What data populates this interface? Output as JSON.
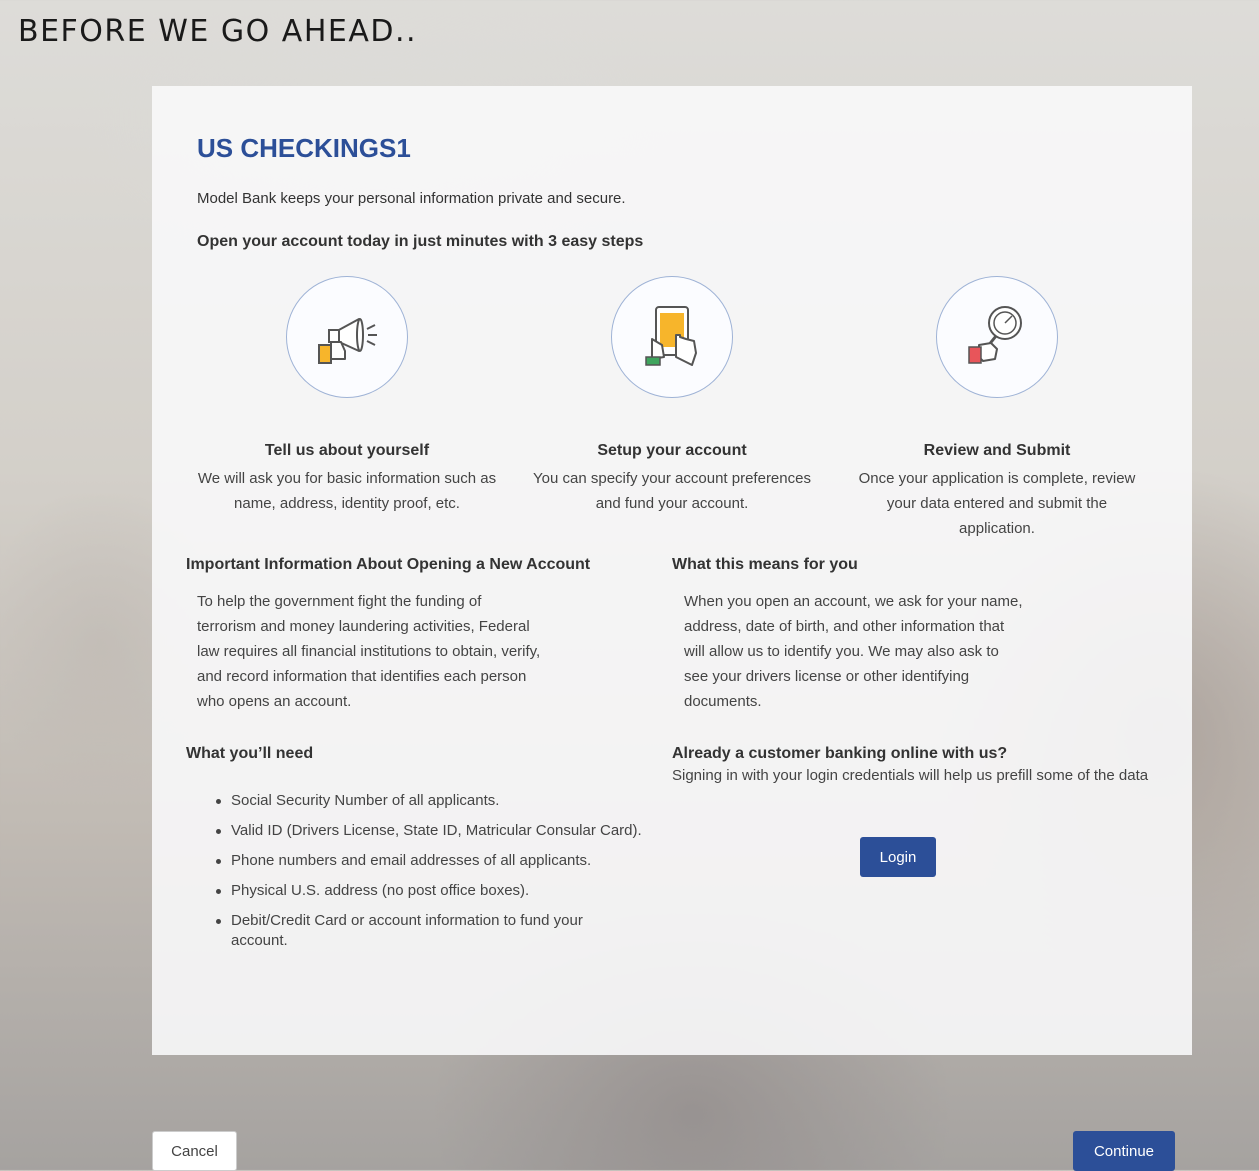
{
  "page": {
    "title": "BEFORE WE GO AHEAD.."
  },
  "product": {
    "name": "US CHECKINGS1"
  },
  "intro": {
    "privacy_text": "Model Bank keeps your personal information private and secure.",
    "steps_heading": "Open your account today in just minutes with 3 easy steps"
  },
  "steps": [
    {
      "icon": "megaphone-icon",
      "title": "Tell us about yourself",
      "description": "We will ask you for basic information such as name, address, identity proof, etc."
    },
    {
      "icon": "tablet-touch-icon",
      "title": "Setup your account",
      "description": "You can specify your account preferences and fund your account."
    },
    {
      "icon": "magnifier-icon",
      "title": "Review and Submit",
      "description": "Once your application is complete, review your data entered and submit the application."
    }
  ],
  "important": {
    "title": "Important Information About Opening a New Account",
    "text": "To help the government fight the funding of terrorism and money laundering activities, Federal law requires all financial institutions to obtain, verify, and record information that identifies each person who opens an account."
  },
  "means": {
    "title": "What this means for you",
    "text": "When you open an account, we ask for your name, address, date of birth, and other information that will allow us to identify you. We may also ask to see your drivers license or other identifying documents."
  },
  "needs": {
    "title": "What you’ll need",
    "items": [
      "Social Security Number of all applicants.",
      "Valid ID (Drivers License, State ID, Matricular Consular Card).",
      "Phone numbers and email addresses of all applicants.",
      "Physical U.S. address (no post office boxes).",
      "Debit/Credit Card or account information to fund your account."
    ]
  },
  "customer": {
    "title": "Already a customer banking online with us?",
    "text": "Signing in with your login credentials will help us prefill some of the data",
    "login_label": "Login"
  },
  "footer": {
    "cancel_label": "Cancel",
    "continue_label": "Continue"
  },
  "colors": {
    "primary": "#2c4f98",
    "orange": "#f7b52b",
    "green": "#3fa55e",
    "red": "#e8555a"
  }
}
